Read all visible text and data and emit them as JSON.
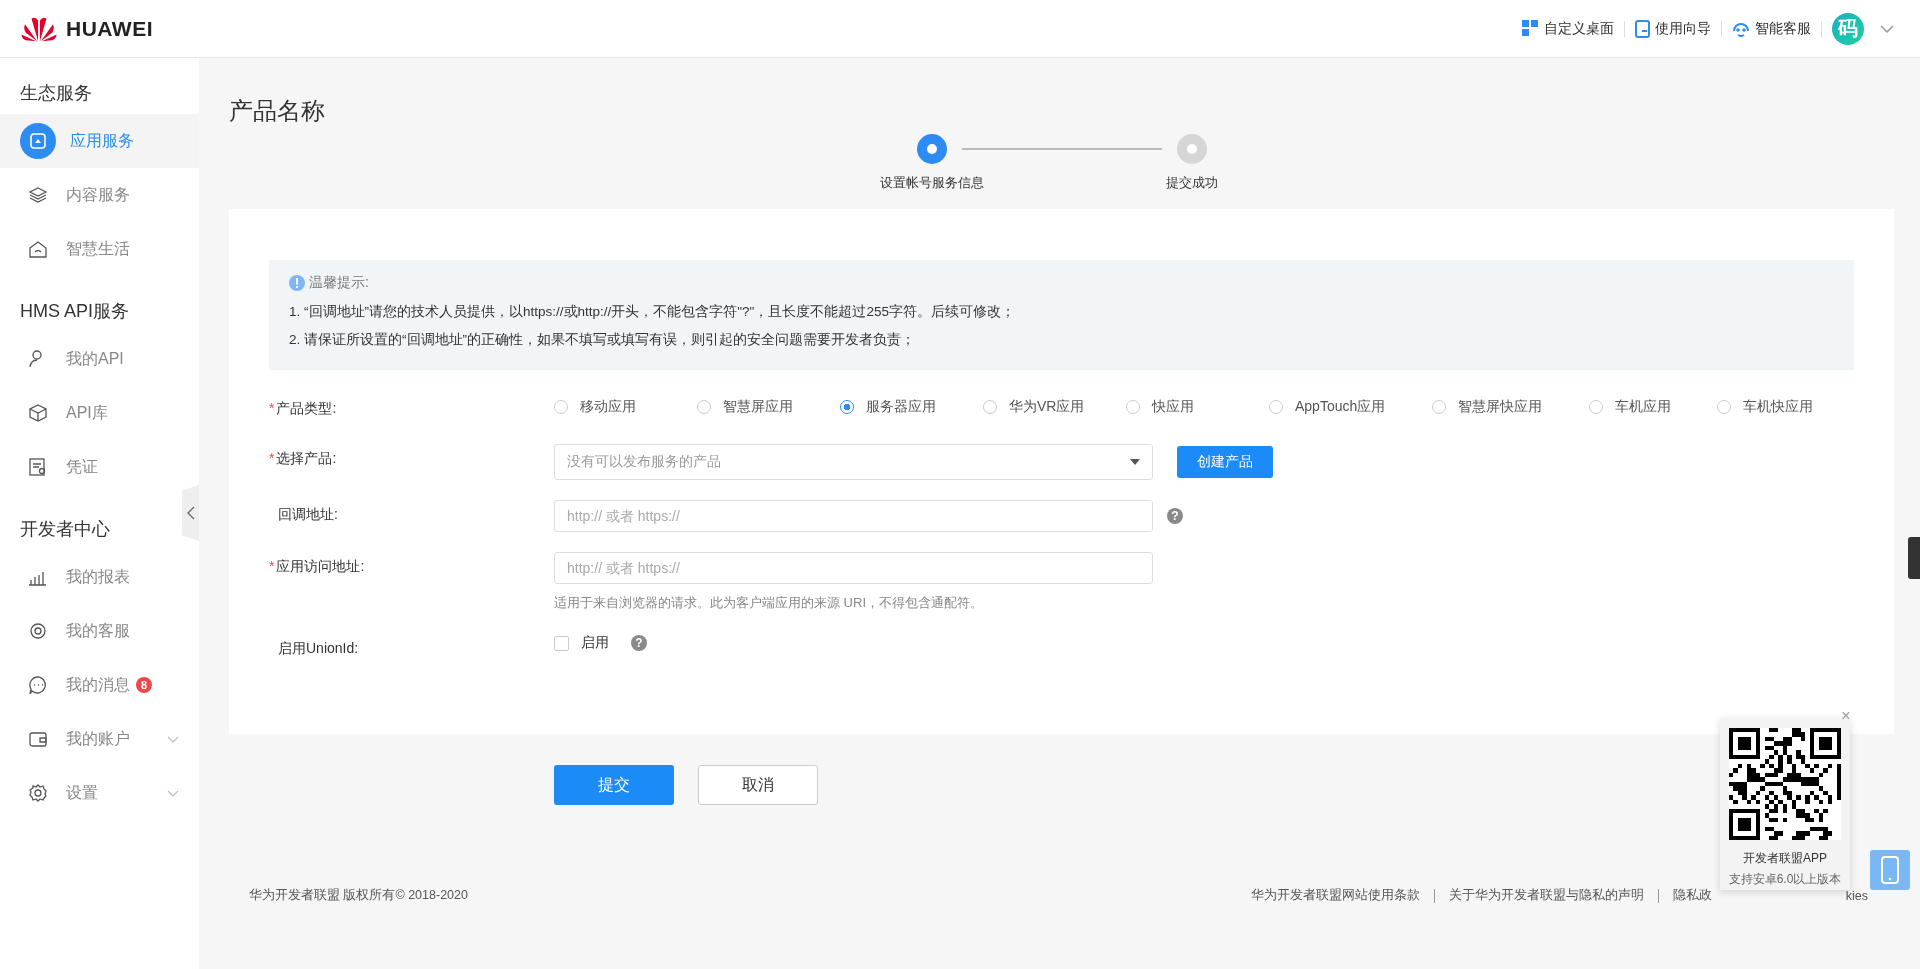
{
  "header": {
    "brand": "HUAWEI",
    "tools": [
      {
        "label": "自定义桌面"
      },
      {
        "label": "使用向导"
      },
      {
        "label": "智能客服"
      }
    ],
    "avatar": "码"
  },
  "sidebar": {
    "sections": [
      {
        "title": "生态服务",
        "items": [
          {
            "label": "应用服务",
            "selected": true,
            "kind": "link"
          },
          {
            "label": "内容服务",
            "selected": false,
            "kind": "link"
          },
          {
            "label": "智慧生活",
            "selected": false,
            "kind": "link"
          }
        ]
      },
      {
        "title": "HMS API服务",
        "items": [
          {
            "label": "我的API",
            "selected": false,
            "kind": "link"
          },
          {
            "label": "API库",
            "selected": false,
            "kind": "link"
          },
          {
            "label": "凭证",
            "selected": false,
            "kind": "link"
          }
        ]
      },
      {
        "title": "开发者中心",
        "items": [
          {
            "label": "我的报表",
            "selected": false,
            "kind": "link"
          },
          {
            "label": "我的客服",
            "selected": false,
            "kind": "link"
          },
          {
            "label": "我的消息",
            "selected": false,
            "kind": "link",
            "badge": "8"
          },
          {
            "label": "我的账户",
            "selected": false,
            "kind": "menu"
          },
          {
            "label": "设置",
            "selected": false,
            "kind": "menu"
          }
        ]
      }
    ]
  },
  "page_title": "产品名称",
  "steps": [
    {
      "label": "设置帐号服务信息",
      "active": true
    },
    {
      "label": "提交成功",
      "active": false
    }
  ],
  "notice": {
    "title": "温馨提示:",
    "lines": [
      "1. “回调地址”请您的技术人员提供，以https://或http://开头，不能包含字符\"?\"，且长度不能超过255字符。后续可修改；",
      "2. 请保证所设置的“回调地址”的正确性，如果不填写或填写有误，则引起的安全问题需要开发者负责；"
    ]
  },
  "form": [
    {
      "kind": "radio",
      "mark": "*",
      "label": "产品类型:",
      "options": [
        {
          "label": "移动应用",
          "selected": false
        },
        {
          "label": "智慧屏应用",
          "selected": false
        },
        {
          "label": "服务器应用",
          "selected": true
        },
        {
          "label": "华为VR应用",
          "selected": false
        },
        {
          "label": "快应用",
          "selected": false
        },
        {
          "label": "AppTouch应用",
          "selected": false
        },
        {
          "label": "智慧屏快应用",
          "selected": false
        },
        {
          "label": "车机应用",
          "selected": false
        },
        {
          "label": "车机快应用",
          "selected": false
        }
      ]
    },
    {
      "kind": "select",
      "mark": "*",
      "label": "选择产品:",
      "placeholder": "没有可以发布服务的产品",
      "button": "创建产品"
    },
    {
      "kind": "input",
      "label": "回调地址:",
      "placeholder": "http:// 或者 https://",
      "help": "?"
    },
    {
      "kind": "input",
      "mark": "*",
      "label": "应用访问地址:",
      "placeholder": "http:// 或者 https://",
      "hint": "适用于来自浏览器的请求。此为客户端应用的来源 URI，不得包含通配符。"
    },
    {
      "kind": "checkbox",
      "label": "启用UnionId:",
      "option": "启用",
      "checked": false,
      "help": "?"
    }
  ],
  "actions": [
    {
      "label": "提交",
      "kind": "primary"
    },
    {
      "label": "取消",
      "kind": "default"
    }
  ],
  "footer": {
    "copyright": "华为开发者联盟 版权所有© 2018-2020",
    "links": [
      "华为开发者联盟网站使用条款",
      "关于华为开发者联盟与隐私的声明",
      "隐私政"
    ],
    "tail": "kies"
  },
  "qr_popup": {
    "close": "×",
    "title": "开发者联盟APP",
    "subtitle": "支持安卓6.0以上版本"
  }
}
